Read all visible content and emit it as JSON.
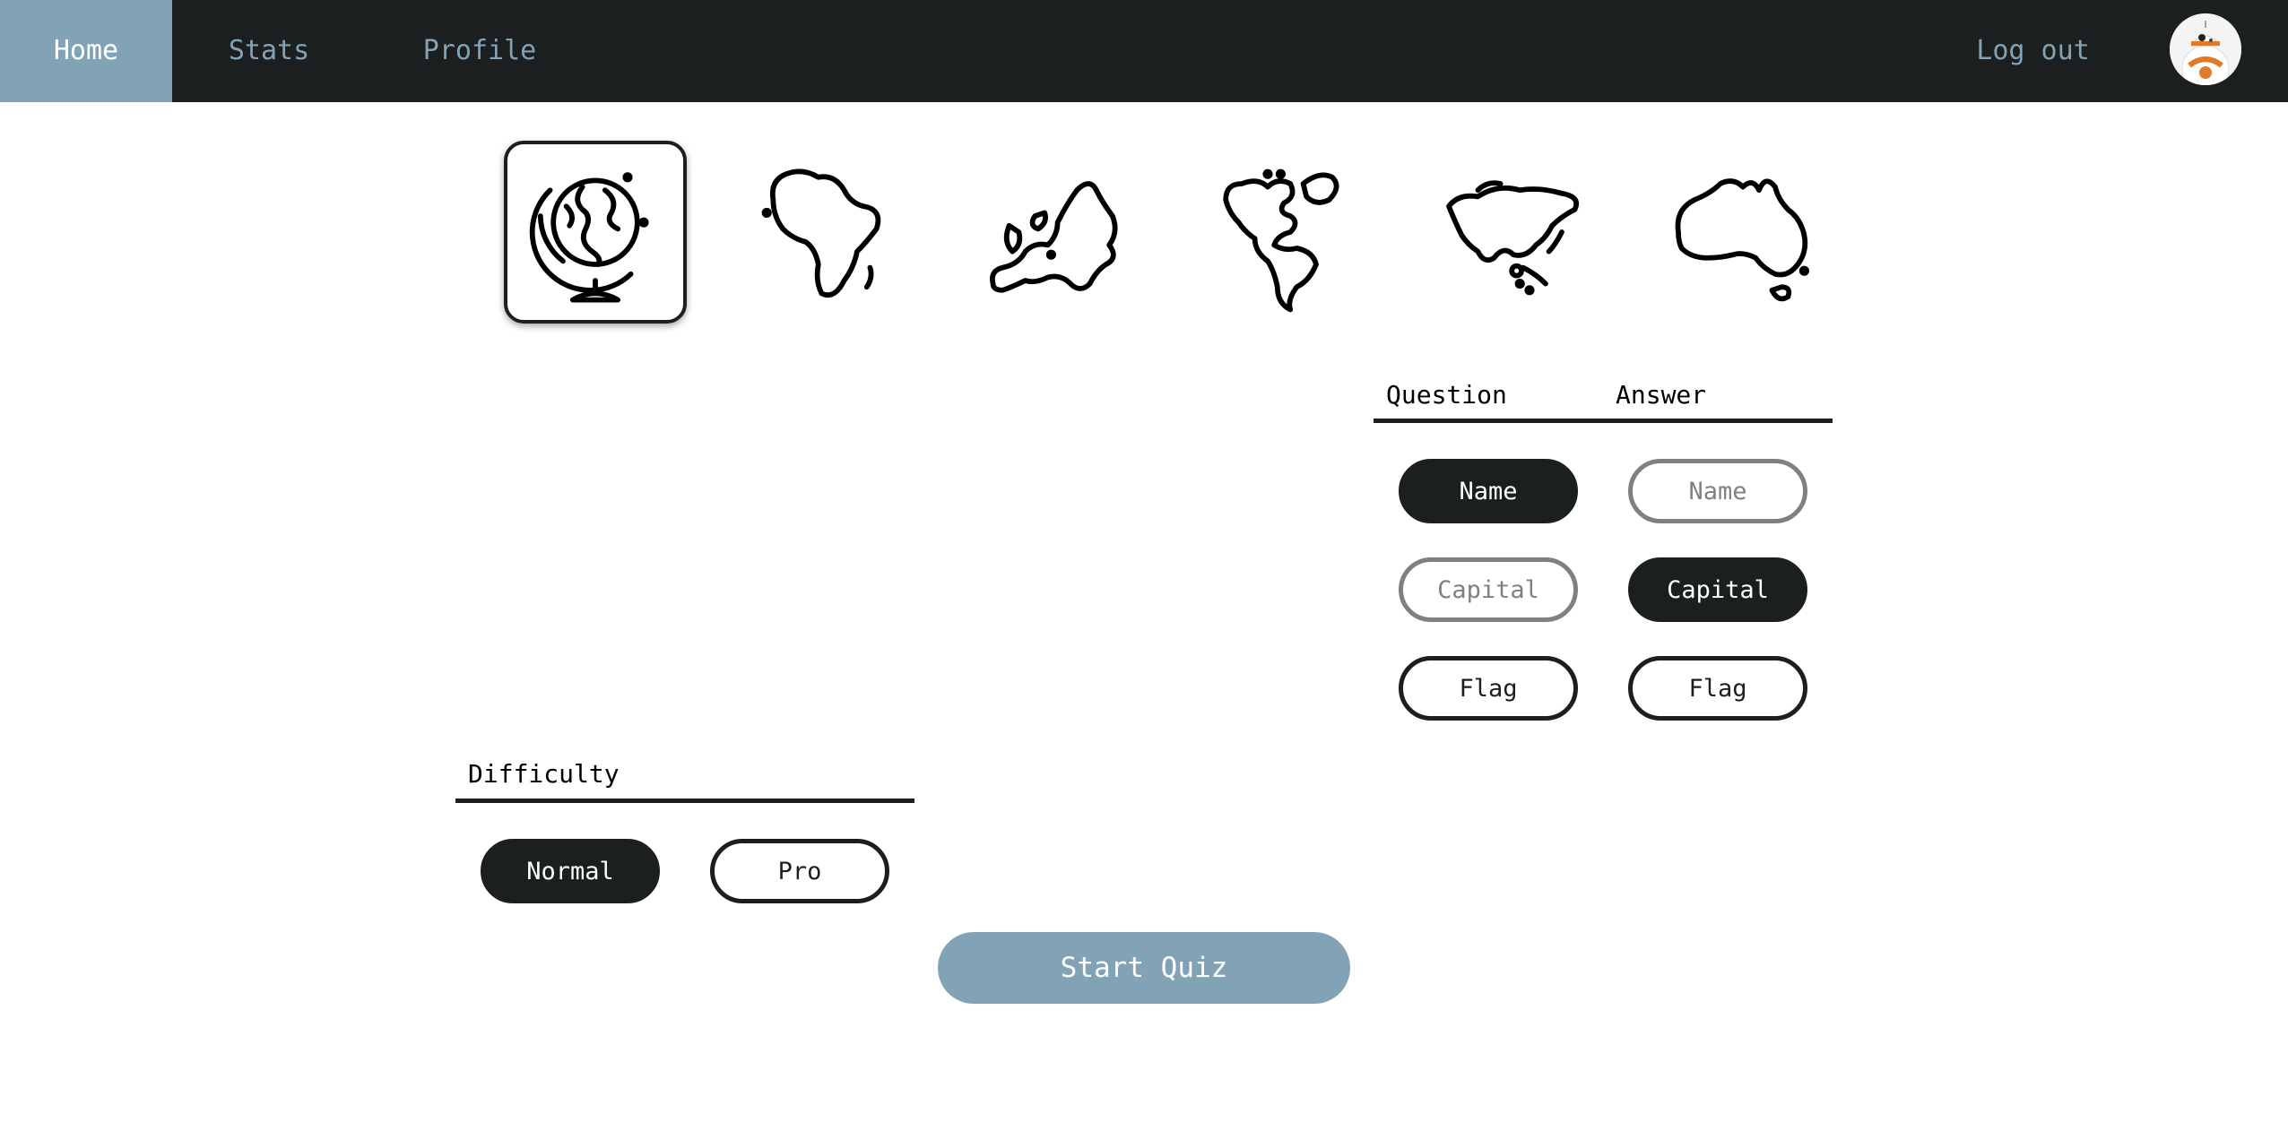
{
  "nav": {
    "home": "Home",
    "stats": "Stats",
    "profile": "Profile",
    "logout": "Log out",
    "active_color": "#82a3b6",
    "bar_color": "#1b1f20"
  },
  "regions": [
    {
      "name": "World",
      "icon": "globe-icon",
      "selected": true
    },
    {
      "name": "Africa",
      "icon": "africa-map-icon",
      "selected": false
    },
    {
      "name": "Europe",
      "icon": "europe-map-icon",
      "selected": false
    },
    {
      "name": "Americas",
      "icon": "americas-map-icon",
      "selected": false
    },
    {
      "name": "Asia",
      "icon": "asia-map-icon",
      "selected": false
    },
    {
      "name": "Oceania",
      "icon": "oceania-map-icon",
      "selected": false
    }
  ],
  "quiz": {
    "question_label": "Question",
    "answer_label": "Answer",
    "question_options": [
      {
        "label": "Name",
        "state": "selected"
      },
      {
        "label": "Capital",
        "state": "disabled"
      },
      {
        "label": "Flag",
        "state": "unselected"
      }
    ],
    "answer_options": [
      {
        "label": "Name",
        "state": "disabled"
      },
      {
        "label": "Capital",
        "state": "selected"
      },
      {
        "label": "Flag",
        "state": "unselected"
      }
    ]
  },
  "difficulty": {
    "label": "Difficulty",
    "options": [
      {
        "label": "Normal",
        "state": "selected"
      },
      {
        "label": "Pro",
        "state": "unselected"
      }
    ]
  },
  "start_label": "Start Quiz"
}
